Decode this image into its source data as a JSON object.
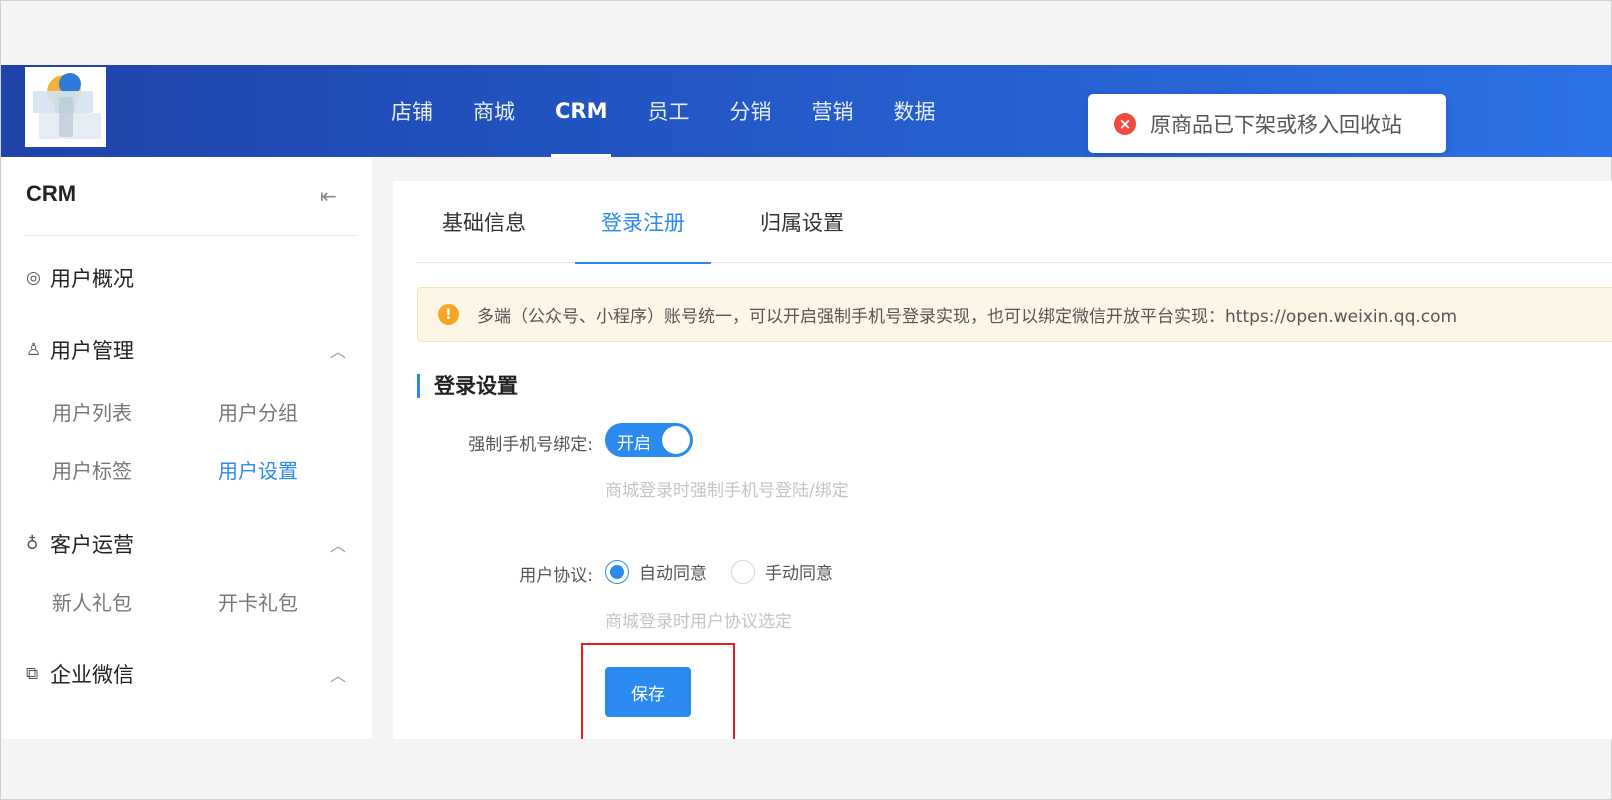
{
  "header": {
    "nav": [
      "店铺",
      "商城",
      "CRM",
      "员工",
      "分销",
      "营销",
      "数据"
    ],
    "active_nav": "CRM"
  },
  "toast": {
    "message": "原商品已下架或移入回收站",
    "icon": "error-circle-icon"
  },
  "sidebar": {
    "title": "CRM",
    "groups": [
      {
        "label": "用户概况",
        "icon": "user-overview-icon",
        "items": []
      },
      {
        "label": "用户管理",
        "icon": "user-manage-icon",
        "items": [
          "用户列表",
          "用户分组",
          "用户标签",
          "用户设置"
        ]
      },
      {
        "label": "客户运营",
        "icon": "customer-ops-icon",
        "items": [
          "新人礼包",
          "开卡礼包"
        ]
      },
      {
        "label": "企业微信",
        "icon": "wechat-work-icon",
        "items": []
      }
    ],
    "active_item": "用户设置"
  },
  "tabs": [
    "基础信息",
    "登录注册",
    "归属设置"
  ],
  "active_tab": "登录注册",
  "alert": {
    "text": "多端（公众号、小程序）账号统一，可以开启强制手机号登录实现，也可以绑定微信开放平台实现：https://open.weixin.qq.com"
  },
  "section": {
    "title": "登录设置"
  },
  "form": {
    "force_phone_label": "强制手机号绑定:",
    "switch_text": "开启",
    "force_phone_hint": "商城登录时强制手机号登陆/绑定",
    "agreement_label": "用户协议:",
    "agreement_options": [
      "自动同意",
      "手动同意"
    ],
    "agreement_selected": "自动同意",
    "agreement_hint": "商城登录时用户协议选定",
    "save_label": "保存"
  },
  "colors": {
    "primary": "#2a8af0",
    "nav_start": "#1f43a8",
    "nav_end": "#2c72e6",
    "highlight": "#e0201f"
  }
}
